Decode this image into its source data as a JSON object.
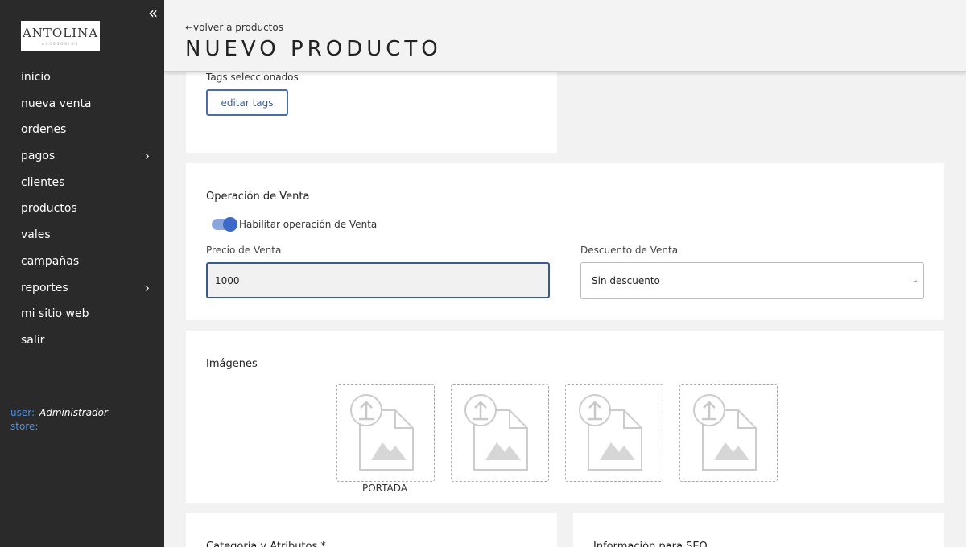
{
  "sidebar": {
    "logo_text": "ANTOLINA",
    "logo_sub": "ACCESORIOS",
    "collapse_icon": "«",
    "items": [
      {
        "label": "inicio",
        "chevron": false
      },
      {
        "label": "nueva venta",
        "chevron": false
      },
      {
        "label": "ordenes",
        "chevron": false
      },
      {
        "label": "pagos",
        "chevron": true
      },
      {
        "label": "clientes",
        "chevron": false
      },
      {
        "label": "productos",
        "chevron": false
      },
      {
        "label": "vales",
        "chevron": false
      },
      {
        "label": "campañas",
        "chevron": false
      },
      {
        "label": "reportes",
        "chevron": true
      },
      {
        "label": "mi sitio web",
        "chevron": false
      },
      {
        "label": "salir",
        "chevron": false
      }
    ],
    "user_key": "user:",
    "user_value": "Administrador",
    "store_key": "store:",
    "store_value": ""
  },
  "header": {
    "back_link": "←volver a productos",
    "title": "NUEVO PRODUCTO"
  },
  "tags": {
    "label": "Tags seleccionados",
    "edit_button": "editar tags"
  },
  "venta": {
    "title": "Operación de Venta",
    "toggle_label": "Habilitar operación de Venta",
    "toggle_on": true,
    "price_label": "Precio de Venta",
    "price_value": "1000",
    "discount_label": "Descuento de Venta",
    "discount_value": "Sin descuento"
  },
  "images": {
    "title": "Imágenes",
    "portada_label": "PORTADA",
    "slot_icon": "image-upload-icon"
  },
  "bottom": {
    "category_title": "Categoría y Atributos *",
    "seo_title": "Información para SEO"
  },
  "colors": {
    "sidebar_bg": "#2a2a2a",
    "accent": "#3d6ac9",
    "user_label": "#4a8fe8"
  }
}
